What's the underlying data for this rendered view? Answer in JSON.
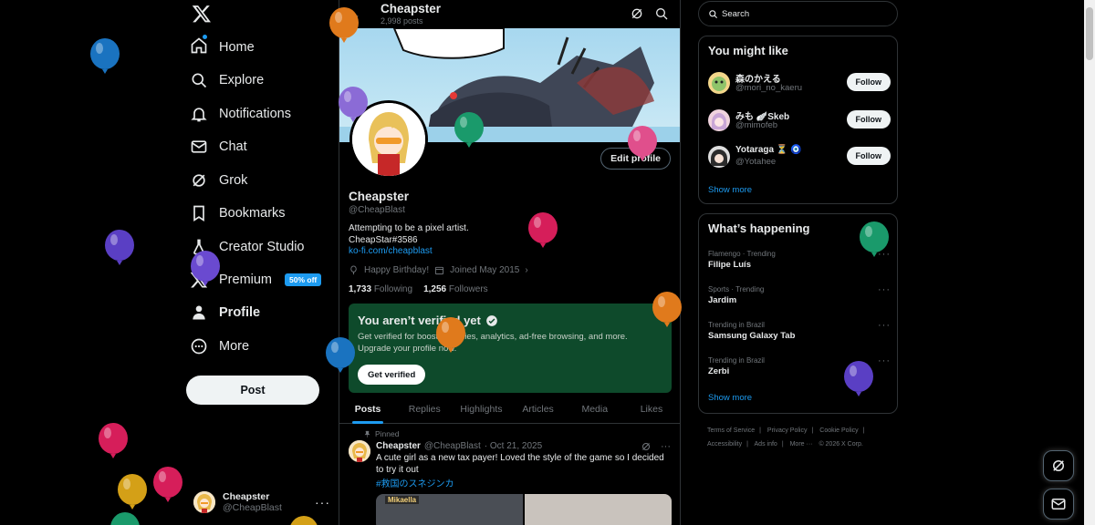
{
  "colors": {
    "accent": "#1d9bf0",
    "verify_bg": "#0e4a2b",
    "border": "#2f3336"
  },
  "nav": {
    "logo": "x-logo-icon",
    "items": [
      {
        "label": "Home",
        "icon": "home-icon"
      },
      {
        "label": "Explore",
        "icon": "search-icon"
      },
      {
        "label": "Notifications",
        "icon": "bell-icon"
      },
      {
        "label": "Chat",
        "icon": "mail-icon"
      },
      {
        "label": "Grok",
        "icon": "grok-icon"
      },
      {
        "label": "Bookmarks",
        "icon": "bookmark-icon"
      },
      {
        "label": "Creator Studio",
        "icon": "flask-icon"
      },
      {
        "label": "Premium",
        "icon": "x-premium-icon",
        "badge": "50% off"
      },
      {
        "label": "Profile",
        "icon": "person-icon"
      },
      {
        "label": "More",
        "icon": "more-circle-icon"
      }
    ],
    "post_label": "Post",
    "account": {
      "name": "Cheapster",
      "handle": "@CheapBlast"
    }
  },
  "main": {
    "header": {
      "name": "Cheapster",
      "posts": "2,998 posts"
    },
    "profile": {
      "edit_label": "Edit profile",
      "name": "Cheapster",
      "handle": "@CheapBlast",
      "bio_line1": "Attempting to be a pixel artist.",
      "bio_line2": "CheapStar#3586",
      "link": "ko-fi.com/cheapblast",
      "birthday": "Happy Birthday!",
      "joined": "Joined May 2015",
      "following_count": "1,733",
      "following_label": "Following",
      "followers_count": "1,256",
      "followers_label": "Followers"
    },
    "verify": {
      "title": "You aren’t verified yet",
      "text": "Get verified for boosted replies, analytics, ad-free browsing, and more. Upgrade your profile now.",
      "button": "Get verified"
    },
    "tabs": [
      "Posts",
      "Replies",
      "Highlights",
      "Articles",
      "Media",
      "Likes"
    ],
    "tweet": {
      "pinned": "Pinned",
      "name": "Cheapster",
      "handle": "@CheapBlast",
      "date": "· Oct 21, 2025",
      "text": "A cute girl as a new tax payer! Loved the style of the game so I decided to try it out",
      "hashtag": "#救国のスネジンカ",
      "media_label": "Mikaella"
    }
  },
  "right": {
    "search_placeholder": "Search",
    "might_like": {
      "title": "You might like",
      "users": [
        {
          "name": "森のかえる",
          "handle": "@mori_no_kaeru",
          "button": "Follow"
        },
        {
          "name": "みも 🪽Skeb",
          "handle": "@mimofeb",
          "button": "Follow"
        },
        {
          "name": "Yotaraga ⏳ 🧿",
          "handle": "@Yotahee",
          "button": "Follow"
        }
      ],
      "show_more": "Show more"
    },
    "happening": {
      "title": "What’s happening",
      "trends": [
        {
          "context": "Flamengo · Trending",
          "topic": "Filipe Luís"
        },
        {
          "context": "Sports · Trending",
          "topic": "Jardim"
        },
        {
          "context": "Trending in Brazil",
          "topic": "Samsung Galaxy Tab"
        },
        {
          "context": "Trending in Brazil",
          "topic": "Zerbi"
        }
      ],
      "show_more": "Show more"
    },
    "footer": {
      "links": [
        "Terms of Service",
        "|",
        "Privacy Policy",
        "|",
        "Cookie Policy",
        "|",
        "Accessibility",
        "|",
        "Ads info",
        "|",
        "More ···",
        "© 2026 X Corp."
      ]
    }
  }
}
